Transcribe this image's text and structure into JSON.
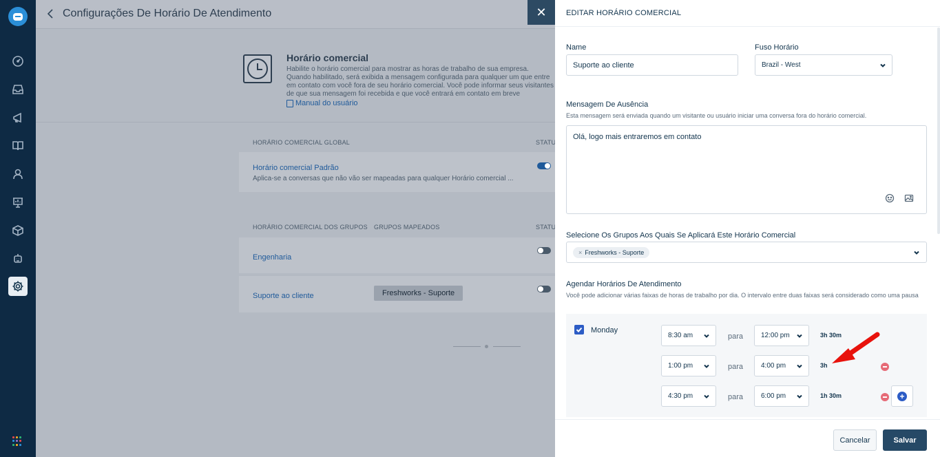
{
  "sidebar": {
    "items": [
      {
        "icon": "dashboard-icon"
      },
      {
        "icon": "inbox-icon"
      },
      {
        "icon": "campaigns-icon"
      },
      {
        "icon": "solutions-book-icon"
      },
      {
        "icon": "contacts-icon"
      },
      {
        "icon": "reports-icon"
      },
      {
        "icon": "integrations-cube-icon"
      },
      {
        "icon": "bots-icon"
      },
      {
        "icon": "settings-gear-icon"
      }
    ],
    "apps_colors": [
      "#e5484d",
      "#f5a623",
      "#2bb673",
      "#2b8fd8",
      "#8e6cc9",
      "#e5484d",
      "#2bb673",
      "#f5a623",
      "#2b8fd8"
    ]
  },
  "background": {
    "page_title": "Configurações De Horário De Atendimento",
    "intro_title": "Horário comercial",
    "intro_desc": "Habilite o horário comercial para mostrar as horas de trabalho de sua empresa. Quando habilitado, será exibida a mensagem configurada para qualquer um que entre em contato com você fora de seu horário comercial. Você pode informar seus visitantes de que sua mensagem foi recebida e que você entrará em contato em breve",
    "manual_link": "Manual do usuário",
    "global_section_label": "HORÁRIO COMERCIAL GLOBAL",
    "status_label": "STATUS",
    "default_title": "Horário comercial Padrão",
    "default_desc": "Aplica-se a conversas que não vão ser mapeadas para qualquer Horário comercial ...",
    "groups_section_label": "HORÁRIO COMERCIAL DOS GRUPOS",
    "mapped_groups_label": "GRUPOS MAPEADOS",
    "group_rows": [
      {
        "name": "Engenharia",
        "tag": ""
      },
      {
        "name": "Suporte ao cliente",
        "tag": "Freshworks - Suporte"
      }
    ]
  },
  "drawer": {
    "title": "EDITAR HORÁRIO COMERCIAL",
    "name_label": "Name",
    "name_value": "Suporte ao cliente",
    "timezone_label": "Fuso Horário",
    "timezone_value": "Brazil - West",
    "away_label": "Mensagem De Ausência",
    "away_hint": "Esta mensagem será enviada quando um visitante ou usuário iniciar uma conversa fora do horário comercial.",
    "away_message": "Olá, logo mais entraremos em contato",
    "groups_label": "Selecione Os Grupos Aos Quais Se Aplicará Este Horário Comercial",
    "groups_selected": "Freshworks - Suporte",
    "chip_remove": "×",
    "schedule_label": "Agendar Horários De Atendimento",
    "schedule_hint": "Você pode adicionar várias faixas de horas de trabalho por dia. O intervalo entre duas faixas será considerado como uma pausa",
    "day": "Monday",
    "slots": [
      {
        "from": "8:30 am",
        "sep": "para",
        "to": "12:00 pm",
        "duration": "3h 30m"
      },
      {
        "from": "1:00 pm",
        "sep": "para",
        "to": "4:00 pm",
        "duration": "3h"
      },
      {
        "from": "4:30 pm",
        "sep": "para",
        "to": "6:00 pm",
        "duration": "1h 30m"
      }
    ],
    "cancel_label": "Cancelar",
    "save_label": "Salvar"
  },
  "close_label": "✕",
  "colors": {
    "sidebar_bg": "#0e2a44",
    "primary": "#2c5cc5",
    "save_btn": "#264966",
    "remove_red": "#e66b77",
    "arrow_red": "#e8120c"
  }
}
